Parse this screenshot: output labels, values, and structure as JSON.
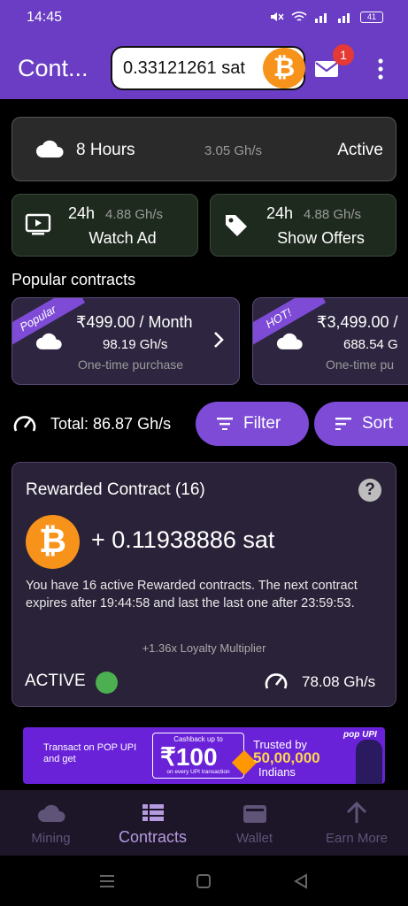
{
  "status_bar": {
    "time": "14:45",
    "battery": "41"
  },
  "app_bar": {
    "title": "Cont...",
    "balance": "0.33121261 sat",
    "coin_symbol": "₿",
    "notification_count": "1"
  },
  "active_plan": {
    "hours": "8 Hours",
    "speed": "3.05 Gh/s",
    "status": "Active"
  },
  "boosts": [
    {
      "hours": "24h",
      "speed": "4.88 Gh/s",
      "label": "Watch Ad",
      "icon": "tv-play-icon"
    },
    {
      "hours": "24h",
      "speed": "4.88 Gh/s",
      "label": "Show Offers",
      "icon": "tag-icon"
    }
  ],
  "popular": {
    "title": "Popular contracts",
    "items": [
      {
        "ribbon": "Popular",
        "price": "₹499.00 / Month",
        "speed": "98.19 Gh/s",
        "note": "One-time purchase"
      },
      {
        "ribbon": "HOT!",
        "price": "₹3,499.00 /",
        "speed": "688.54 G",
        "note": "One-time pu"
      }
    ]
  },
  "filter_row": {
    "total": "Total: 86.87 Gh/s",
    "filter_label": "Filter",
    "sort_label": "Sort"
  },
  "rewarded": {
    "title": "Rewarded Contract (16)",
    "help": "?",
    "coin_symbol": "₿",
    "amount": "+ 0.11938886 sat",
    "description": "You have 16 active Rewarded contracts. The next contract expires after 19:44:58 and last the last one after 23:59:53.",
    "multiplier": "+1.36x Loyalty Multiplier",
    "status": "ACTIVE",
    "rate": "78.08 Gh/s"
  },
  "banner": {
    "left_text": "Transact on POP UPI and get",
    "cashback": "Cashback up to",
    "amount": "₹100",
    "every": "on every UPI transaction",
    "trusted": "Trusted by",
    "count": "50,00,000",
    "indians": "Indians",
    "brand": "pop UPI"
  },
  "nav": {
    "items": [
      {
        "label": "Mining",
        "icon": "cloud-icon"
      },
      {
        "label": "Contracts",
        "icon": "list-icon"
      },
      {
        "label": "Wallet",
        "icon": "wallet-icon"
      },
      {
        "label": "Earn More",
        "icon": "arrow-up-icon"
      }
    ],
    "active_index": 1
  },
  "colors": {
    "primary": "#6a3dc4",
    "accent": "#7d4bd6",
    "bitcoin": "#f7931a",
    "active_green": "#4caf50"
  }
}
